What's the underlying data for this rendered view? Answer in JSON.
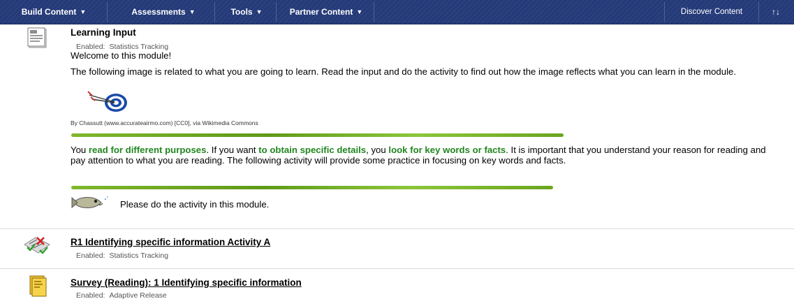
{
  "toolbar": {
    "build_content": "Build Content",
    "assessments": "Assessments",
    "tools": "Tools",
    "partner_content": "Partner Content",
    "discover_content": "Discover Content",
    "reorder_icon": "↑↓"
  },
  "items": [
    {
      "title": "Learning Input",
      "meta_key": "Enabled:",
      "meta_value": "Statistics Tracking",
      "welcome": "Welcome to this module!",
      "intro": "The following image is related to what you are going to learn. Read the input and do the activity to find out how the image reflects what you can learn in the module.",
      "credit": "By Chassutt (www.accurateairmo.com) [CC0], via Wikimedia Commons",
      "para": {
        "t1": "You ",
        "g1": "read for different purposes",
        "t2": ". If you want ",
        "g2": "to obtain specific details",
        "t3": ", you ",
        "g3": "look for key words or facts",
        "t4": ". It is important that you understand your reason for reading and pay attention to what you are reading. The following activity will provide some practice in focusing on key words and facts."
      },
      "activity_note": "Please do the activity in this module."
    },
    {
      "title": "R1 Identifying specific information Activity A",
      "meta_key": "Enabled:",
      "meta_value": "Statistics Tracking"
    },
    {
      "title": "Survey (Reading): 1 Identifying specific information",
      "meta_key": "Enabled:",
      "meta_value": "Adaptive Release"
    }
  ],
  "icons": {
    "item1": "document-icon",
    "item2": "test-icon",
    "item3": "survey-icon",
    "target": "target-icon",
    "fish": "fish-icon"
  },
  "colors": {
    "toolbar": "#243978",
    "highlight_green": "#21861f",
    "brush_green": "#7fb72b"
  }
}
